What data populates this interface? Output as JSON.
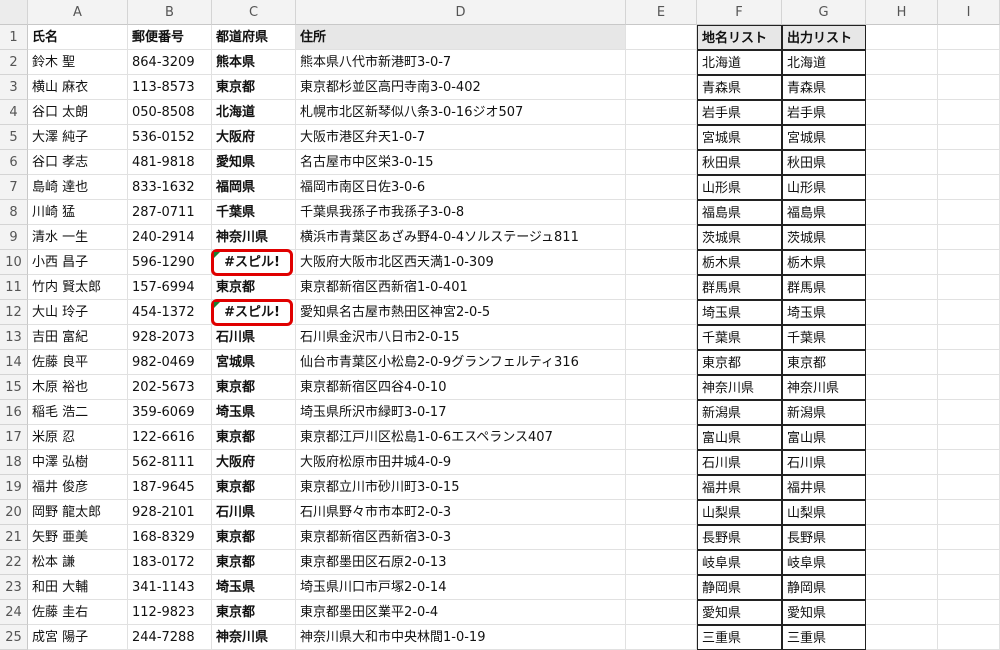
{
  "columns": [
    "A",
    "B",
    "C",
    "D",
    "E",
    "F",
    "G",
    "H",
    "I"
  ],
  "row_numbers": [
    "1",
    "2",
    "3",
    "4",
    "5",
    "6",
    "7",
    "8",
    "9",
    "10",
    "11",
    "12",
    "13",
    "14",
    "15",
    "16",
    "17",
    "18",
    "19",
    "20",
    "21",
    "22",
    "23",
    "24",
    "25"
  ],
  "headers": {
    "name": "氏名",
    "zip": "郵便番号",
    "pref": "都道府県",
    "addr": "住所",
    "list": "地名リスト",
    "out": "出力リスト"
  },
  "rows": [
    {
      "name": "鈴木 聖",
      "zip": "864-3209",
      "pref": "熊本県",
      "addr": "熊本県八代市新港町3-0-7"
    },
    {
      "name": "横山 麻衣",
      "zip": "113-8573",
      "pref": "東京都",
      "addr": "東京都杉並区高円寺南3-0-402"
    },
    {
      "name": "谷口 太朗",
      "zip": "050-8508",
      "pref": "北海道",
      "addr": "札幌市北区新琴似八条3-0-16ジオ507"
    },
    {
      "name": "大澤 純子",
      "zip": "536-0152",
      "pref": "大阪府",
      "addr": "大阪市港区弁天1-0-7"
    },
    {
      "name": "谷口 孝志",
      "zip": "481-9818",
      "pref": "愛知県",
      "addr": "名古屋市中区栄3-0-15"
    },
    {
      "name": "島崎 達也",
      "zip": "833-1632",
      "pref": "福岡県",
      "addr": "福岡市南区日佐3-0-6"
    },
    {
      "name": "川崎 猛",
      "zip": "287-0711",
      "pref": "千葉県",
      "addr": "千葉県我孫子市我孫子3-0-8"
    },
    {
      "name": "清水 一生",
      "zip": "240-2914",
      "pref": "神奈川県",
      "addr": "横浜市青葉区あざみ野4-0-4ソルステージュ811"
    },
    {
      "name": "小西 昌子",
      "zip": "596-1290",
      "pref": "#スピル!",
      "addr": "大阪府大阪市北区西天満1-0-309",
      "spill": true
    },
    {
      "name": "竹内 賢太郎",
      "zip": "157-6994",
      "pref": "東京都",
      "addr": "東京都新宿区西新宿1-0-401"
    },
    {
      "name": "大山 玲子",
      "zip": "454-1372",
      "pref": "#スピル!",
      "addr": "愛知県名古屋市熱田区神宮2-0-5",
      "spill": true
    },
    {
      "name": "吉田 富紀",
      "zip": "928-2073",
      "pref": "石川県",
      "addr": "石川県金沢市八日市2-0-15"
    },
    {
      "name": "佐藤 良平",
      "zip": "982-0469",
      "pref": "宮城県",
      "addr": "仙台市青葉区小松島2-0-9グランフェルティ316"
    },
    {
      "name": "木原 裕也",
      "zip": "202-5673",
      "pref": "東京都",
      "addr": "東京都新宿区四谷4-0-10"
    },
    {
      "name": "稲毛 浩二",
      "zip": "359-6069",
      "pref": "埼玉県",
      "addr": "埼玉県所沢市緑町3-0-17"
    },
    {
      "name": "米原 忍",
      "zip": "122-6616",
      "pref": "東京都",
      "addr": "東京都江戸川区松島1-0-6エスペランス407"
    },
    {
      "name": "中澤 弘樹",
      "zip": "562-8111",
      "pref": "大阪府",
      "addr": "大阪府松原市田井城4-0-9"
    },
    {
      "name": "福井 俊彦",
      "zip": "187-9645",
      "pref": "東京都",
      "addr": "東京都立川市砂川町3-0-15"
    },
    {
      "name": "岡野 龍太郎",
      "zip": "928-2101",
      "pref": "石川県",
      "addr": "石川県野々市市本町2-0-3"
    },
    {
      "name": "矢野 亜美",
      "zip": "168-8329",
      "pref": "東京都",
      "addr": "東京都新宿区西新宿3-0-3"
    },
    {
      "name": "松本 謙",
      "zip": "183-0172",
      "pref": "東京都",
      "addr": "東京都墨田区石原2-0-13"
    },
    {
      "name": "和田 大輔",
      "zip": "341-1143",
      "pref": "埼玉県",
      "addr": "埼玉県川口市戸塚2-0-14"
    },
    {
      "name": "佐藤 圭右",
      "zip": "112-9823",
      "pref": "東京都",
      "addr": "東京都墨田区業平2-0-4"
    },
    {
      "name": "成宮 陽子",
      "zip": "244-7288",
      "pref": "神奈川県",
      "addr": "神奈川県大和市中央林間1-0-19"
    }
  ],
  "place_list": [
    "北海道",
    "青森県",
    "岩手県",
    "宮城県",
    "秋田県",
    "山形県",
    "福島県",
    "茨城県",
    "栃木県",
    "群馬県",
    "埼玉県",
    "千葉県",
    "東京都",
    "神奈川県",
    "新潟県",
    "富山県",
    "石川県",
    "福井県",
    "山梨県",
    "長野県",
    "岐阜県",
    "静岡県",
    "愛知県",
    "三重県"
  ],
  "output_list": [
    "北海道",
    "青森県",
    "岩手県",
    "宮城県",
    "秋田県",
    "山形県",
    "福島県",
    "茨城県",
    "栃木県",
    "群馬県",
    "埼玉県",
    "千葉県",
    "東京都",
    "神奈川県",
    "新潟県",
    "富山県",
    "石川県",
    "福井県",
    "山梨県",
    "長野県",
    "岐阜県",
    "静岡県",
    "愛知県",
    "三重県"
  ],
  "colors": {
    "spill_highlight": "#e00000",
    "error_indicator": "#1e7e34",
    "header_bg": "#e7e7e7"
  }
}
